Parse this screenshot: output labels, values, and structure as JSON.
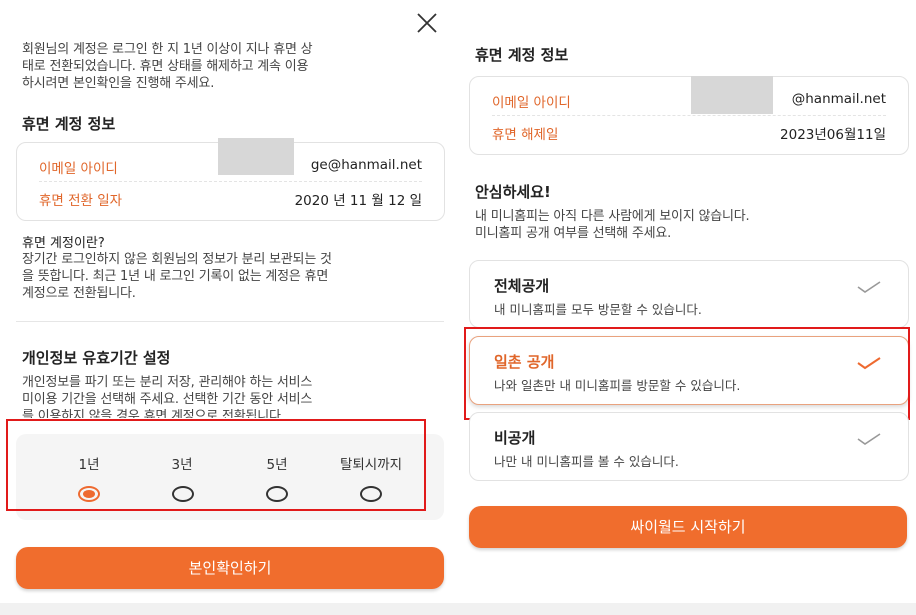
{
  "left": {
    "intro": [
      "회원님의 계정은 로그인 한 지 1년 이상이 지나 휴면 상",
      "태로 전환되었습니다. 휴면 상태를 해제하고 계속 이용",
      "하시려면 본인확인을 진행해 주세요."
    ],
    "dormant_info_title": "휴면 계정 정보",
    "email_label": "이메일 아이디",
    "email_value": "ge@hanmail.net",
    "converted_label": "휴면 전환 일자",
    "converted_value": "2020 년 11 월 12 일",
    "what_is_title": "휴면 계정이란?",
    "what_is_body": [
      "장기간 로그인하지 않은 회원님의 정보가 분리 보관되는 것",
      "을 뜻합니다. 최근 1년 내 로그인 기록이 없는 계정은 휴면",
      "계정으로 전환됩니다."
    ],
    "validity_title": "개인정보 유효기간 설정",
    "validity_body": [
      "개인정보를 파기 또는 분리 저장, 관리해야 하는 서비스",
      "미이용 기간을 선택해 주세요. 선택한 기간 동안 서비스",
      "를 이용하지 않을 경우 휴면 계정으로 전환됩니다."
    ],
    "period_options": [
      "1년",
      "3년",
      "5년",
      "탈퇴시까지"
    ],
    "selected_period": "1년",
    "verify_button": "본인확인하기",
    "close_icon": "close-icon"
  },
  "right": {
    "dormant_info_title": "휴면 계정 정보",
    "email_label": "이메일 아이디",
    "email_value": "@hanmail.net",
    "release_label": "휴면 해제일",
    "release_value": "2023년06월11일",
    "reassure_title": "안심하세요!",
    "reassure_body": [
      "내 미니홈피는 아직 다른 사람에게 보이지 않습니다.",
      "미니홈피 공개 여부를 선택해 주세요."
    ],
    "visibility_options": [
      {
        "title": "전체공개",
        "desc": "내 미니홈피를 모두 방문할 수 있습니다."
      },
      {
        "title": "일촌 공개",
        "desc": "나와 일촌만 내 미니홈피를 방문할 수 있습니다."
      },
      {
        "title": "비공개",
        "desc": "나만 내 미니홈피를 볼 수 있습니다."
      }
    ],
    "selected_visibility": "일촌 공개",
    "start_button": "싸이월드 시작하기"
  },
  "colors": {
    "accent": "#f06d2d",
    "label": "#e0662a",
    "highlight": "#e11a1a"
  }
}
